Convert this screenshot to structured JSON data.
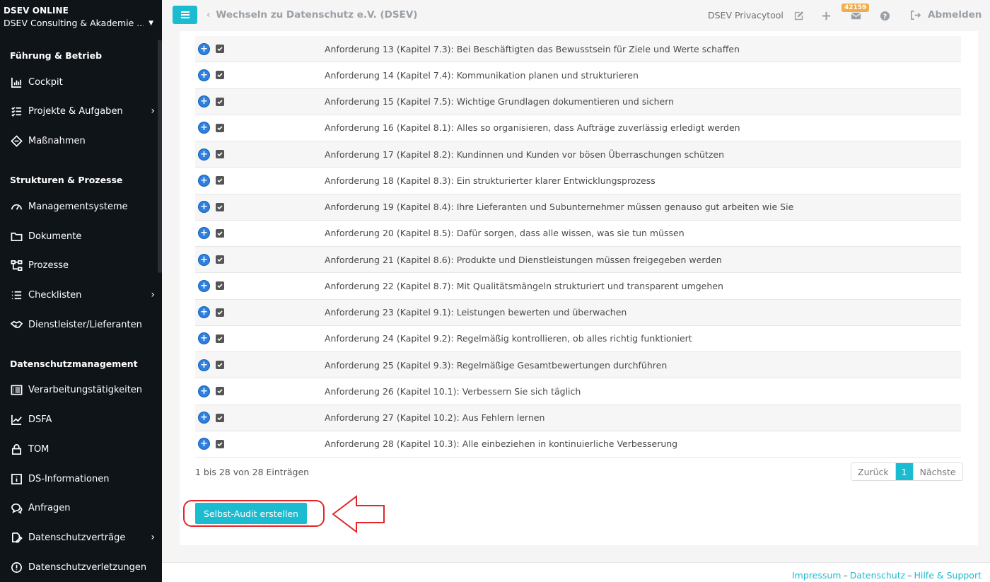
{
  "sidebar": {
    "brand_title": "DSEV ONLINE",
    "brand_sub": "DSEV Consulting & Akademie ...",
    "sections": [
      {
        "title": "Führung & Betrieb"
      },
      {
        "title": "Strukturen & Prozesse"
      },
      {
        "title": "Datenschutzmanagement"
      }
    ],
    "items": [
      {
        "label": "Cockpit",
        "icon": "chart-icon"
      },
      {
        "label": "Projekte & Aufgaben",
        "icon": "tasks-icon"
      },
      {
        "label": "Maßnahmen",
        "icon": "diamond-icon"
      },
      {
        "label": "Managementsysteme",
        "icon": "gauge-icon"
      },
      {
        "label": "Dokumente",
        "icon": "folder-icon"
      },
      {
        "label": "Prozesse",
        "icon": "sitemap-icon"
      },
      {
        "label": "Checklisten",
        "icon": "list-icon"
      },
      {
        "label": "Dienstleister/Lieferanten",
        "icon": "handshake-icon"
      },
      {
        "label": "Verarbeitungstätigkeiten",
        "icon": "table-list-icon"
      },
      {
        "label": "DSFA",
        "icon": "line-chart-icon"
      },
      {
        "label": "TOM",
        "icon": "lock-icon"
      },
      {
        "label": "DS-Informationen",
        "icon": "info-icon"
      },
      {
        "label": "Anfragen",
        "icon": "chat-icon"
      },
      {
        "label": "Datenschutzverträge",
        "icon": "signature-icon"
      },
      {
        "label": "Datenschutzverletzungen",
        "icon": "alert-icon"
      }
    ]
  },
  "topbar": {
    "switch_label": "Wechseln zu Datenschutz e.V. (DSEV)",
    "tool_name": "DSEV Privacytool",
    "mail_badge": "42159",
    "logout_label": "Abmelden"
  },
  "table": {
    "rows": [
      "Anforderung 13 (Kapitel 7.3): Bei Beschäftigten das Bewusstsein für Ziele und Werte schaffen",
      "Anforderung 14 (Kapitel 7.4): Kommunikation planen und strukturieren",
      "Anforderung 15 (Kapitel 7.5): Wichtige Grundlagen dokumentieren und sichern",
      "Anforderung 16 (Kapitel 8.1): Alles so organisieren, dass Aufträge zuverlässig erledigt werden",
      "Anforderung 17 (Kapitel 8.2): Kundinnen und Kunden vor bösen Überraschungen schützen",
      "Anforderung 18 (Kapitel 8.3): Ein strukturierter klarer Entwicklungsprozess",
      "Anforderung 19 (Kapitel 8.4): Ihre Lieferanten und Subunternehmer müssen genauso gut arbeiten wie Sie",
      "Anforderung 20 (Kapitel 8.5): Dafür sorgen, dass alle wissen, was sie tun müssen",
      "Anforderung 21 (Kapitel 8.6): Produkte und Dienstleistungen müssen freigegeben werden",
      "Anforderung 22 (Kapitel 8.7): Mit Qualitätsmängeln strukturiert und transparent umgehen",
      "Anforderung 23 (Kapitel 9.1): Leistungen bewerten und überwachen",
      "Anforderung 24 (Kapitel 9.2): Regelmäßig kontrollieren, ob alles richtig funktioniert",
      "Anforderung 25 (Kapitel 9.3): Regelmäßige Gesamtbewertungen durchführen",
      "Anforderung 26 (Kapitel 10.1): Verbessern Sie sich täglich",
      "Anforderung 27 (Kapitel 10.2): Aus Fehlern lernen",
      "Anforderung 28 (Kapitel 10.3): Alle einbeziehen in kontinuierliche Verbesserung"
    ],
    "info": "1 bis 28 von 28 Einträgen",
    "pager": {
      "prev": "Zurück",
      "page": "1",
      "next": "Nächste"
    }
  },
  "create_button": "Selbst-Audit erstellen",
  "footer": {
    "links": [
      "Impressum",
      "Datenschutz",
      "Hilfe & Support"
    ],
    "separator": "–"
  },
  "colors": {
    "accent": "#1bbcd0",
    "sidebar_bg": "#0f1419",
    "badge": "#f0ad4e",
    "annotation": "#e2262a"
  }
}
